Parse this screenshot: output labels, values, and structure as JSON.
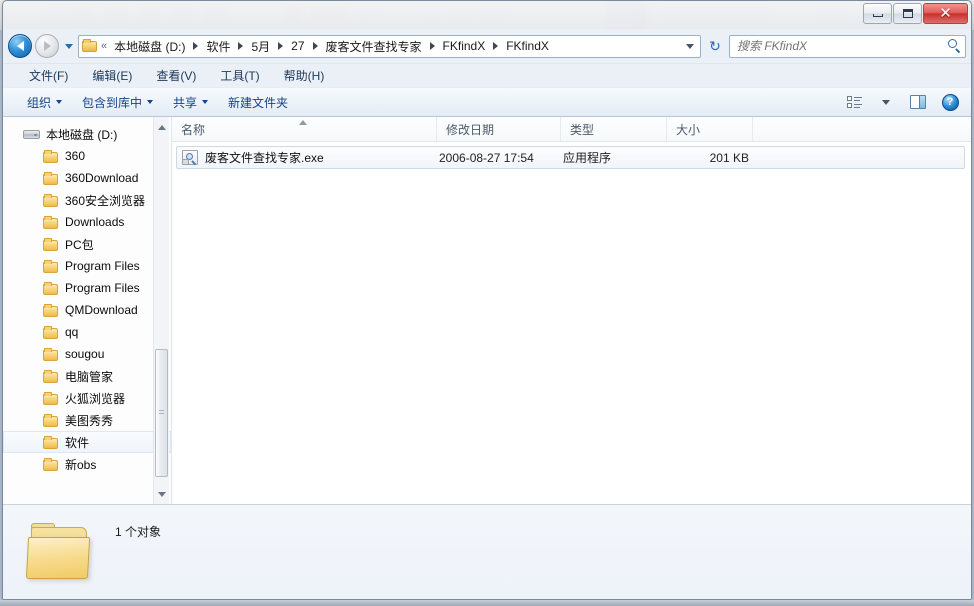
{
  "window": {
    "controls": {
      "minimize_label": "最小化",
      "maximize_label": "最大化",
      "close_label": "✕"
    }
  },
  "address_bar": {
    "back_label": "后退",
    "forward_label": "前进",
    "history_label": "最近浏览的位置",
    "folder_icon": "folder-icon",
    "leading_chevron": "«",
    "breadcrumbs": [
      {
        "label": "本地磁盘 (D:)"
      },
      {
        "label": "软件"
      },
      {
        "label": "5月"
      },
      {
        "label": "27"
      },
      {
        "label": "废客文件查找专家"
      },
      {
        "label": "FKfindX"
      },
      {
        "label": "FKfindX"
      }
    ],
    "dropdown_icon": "chevron-down-icon",
    "refresh_icon": "refresh-icon",
    "refresh_glyph": "↻"
  },
  "search": {
    "placeholder": "搜索 FKfindX",
    "value": "",
    "icon": "search-icon"
  },
  "menu_bar": {
    "items": [
      {
        "label": "文件(F)"
      },
      {
        "label": "编辑(E)"
      },
      {
        "label": "查看(V)"
      },
      {
        "label": "工具(T)"
      },
      {
        "label": "帮助(H)"
      }
    ]
  },
  "toolbar": {
    "buttons": [
      {
        "label": "组织",
        "has_caret": true
      },
      {
        "label": "包含到库中",
        "has_caret": true
      },
      {
        "label": "共享",
        "has_caret": true
      },
      {
        "label": "新建文件夹",
        "has_caret": false
      }
    ],
    "view_button_label": "更改您的视图",
    "preview_button_label": "显示预览窗格",
    "help_button_label": "?",
    "help_title": "获取帮助"
  },
  "sidebar": {
    "root": {
      "label": "本地磁盘 (D:)",
      "icon": "drive-icon"
    },
    "items": [
      {
        "label": "360",
        "icon": "folder-icon",
        "selected": false
      },
      {
        "label": "360Download",
        "icon": "folder-icon",
        "selected": false
      },
      {
        "label": "360安全浏览器",
        "icon": "folder-icon",
        "selected": false
      },
      {
        "label": "Downloads",
        "icon": "folder-icon",
        "selected": false
      },
      {
        "label": "PC包",
        "icon": "folder-icon",
        "selected": false
      },
      {
        "label": "Program Files",
        "icon": "folder-icon",
        "selected": false
      },
      {
        "label": "Program Files",
        "icon": "folder-icon",
        "selected": false
      },
      {
        "label": "QMDownload",
        "icon": "folder-icon",
        "selected": false
      },
      {
        "label": "qq",
        "icon": "folder-icon",
        "selected": false
      },
      {
        "label": "sougou",
        "icon": "folder-icon",
        "selected": false
      },
      {
        "label": "电脑管家",
        "icon": "folder-icon",
        "selected": false
      },
      {
        "label": "火狐浏览器",
        "icon": "folder-icon",
        "selected": false
      },
      {
        "label": "美图秀秀",
        "icon": "folder-icon",
        "selected": false
      },
      {
        "label": "软件",
        "icon": "folder-icon",
        "selected": true
      },
      {
        "label": "新obs",
        "icon": "folder-icon",
        "selected": false
      }
    ],
    "scrollbar": {
      "up_label": "向上滚动",
      "down_label": "向下滚动"
    }
  },
  "file_list": {
    "columns": [
      {
        "key": "name",
        "label": "名称",
        "sorted": "asc"
      },
      {
        "key": "date",
        "label": "修改日期",
        "sorted": ""
      },
      {
        "key": "type",
        "label": "类型",
        "sorted": ""
      },
      {
        "key": "size",
        "label": "大小",
        "sorted": ""
      }
    ],
    "rows": [
      {
        "name": "废客文件查找专家.exe",
        "date": "2006-08-27 17:54",
        "type": "应用程序",
        "size": "201 KB",
        "icon": "application-exe-icon",
        "selected": true
      }
    ]
  },
  "details_pane": {
    "icon": "folder-icon-large",
    "status": "1 个对象"
  },
  "colors": {
    "accent": "#15428b",
    "selection_border": "#cdd9e5",
    "close_button": "#c9302c",
    "folder_yellow": "#f6cd6a",
    "window_border": "#7a899b"
  }
}
